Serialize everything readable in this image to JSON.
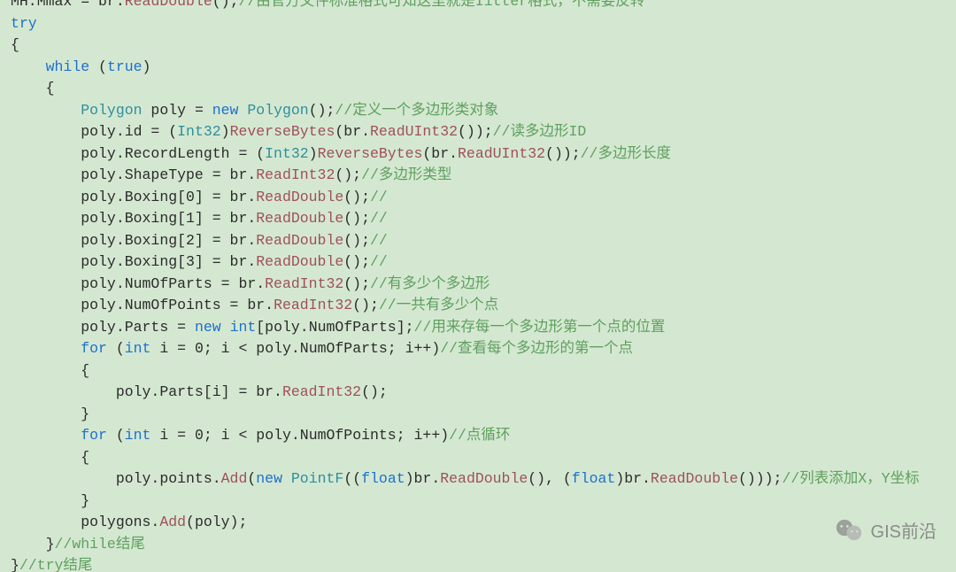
{
  "code": {
    "l00a": "MH.Mmax = ",
    "l00b": "br",
    "l00c": ".",
    "l00d": "ReadDouble",
    "l00e": "();",
    "l00f": "//由官方文件标准格式可知这里就是Iitter格式，不需要反转",
    "l01a": "try",
    "l02a": "{",
    "l03a": "    ",
    "l03b": "while",
    "l03c": " (",
    "l03d": "true",
    "l03e": ")",
    "l04a": "    {",
    "l05i": "        ",
    "l05a": "Polygon",
    "l05b": " poly = ",
    "l05c": "new",
    "l05d": " ",
    "l05e": "Polygon",
    "l05f": "();",
    "l05g": "//定义一个多边形类对象",
    "l06i": "        poly.id = (",
    "l06a": "Int32",
    "l06b": ")",
    "l06c": "ReverseBytes",
    "l06d": "(br.",
    "l06e": "ReadUInt32",
    "l06f": "());",
    "l06g": "//读多边形ID",
    "l07i": "        poly.RecordLength = (",
    "l07a": "Int32",
    "l07b": ")",
    "l07c": "ReverseBytes",
    "l07d": "(br.",
    "l07e": "ReadUInt32",
    "l07f": "());",
    "l07g": "//多边形长度",
    "l08i": "        poly.ShapeType = br.",
    "l08a": "ReadInt32",
    "l08b": "();",
    "l08c": "//多边形类型",
    "l09i": "        poly.Boxing[0] = br.",
    "l09a": "ReadDouble",
    "l09b": "();",
    "l09c": "//",
    "l10i": "        poly.Boxing[1] = br.",
    "l10a": "ReadDouble",
    "l10b": "();",
    "l10c": "//",
    "l11i": "        poly.Boxing[2] = br.",
    "l11a": "ReadDouble",
    "l11b": "();",
    "l11c": "//",
    "l12i": "        poly.Boxing[3] = br.",
    "l12a": "ReadDouble",
    "l12b": "();",
    "l12c": "//",
    "l13i": "        poly.NumOfParts = br.",
    "l13a": "ReadInt32",
    "l13b": "();",
    "l13c": "//有多少个多边形",
    "l14i": "        poly.NumOfPoints = br.",
    "l14a": "ReadInt32",
    "l14b": "();",
    "l14c": "//一共有多少个点",
    "l15i": "        poly.Parts = ",
    "l15a": "new",
    "l15b": " ",
    "l15c": "int",
    "l15d": "[poly.NumOfParts];",
    "l15e": "//用来存每一个多边形第一个点的位置",
    "l16i": "        ",
    "l16a": "for",
    "l16b": " (",
    "l16c": "int",
    "l16d": " i = 0; i < poly.NumOfParts; i++)",
    "l16e": "//查看每个多边形的第一个点",
    "l17i": "        {",
    "l18i": "            poly.Parts[i] = br.",
    "l18a": "ReadInt32",
    "l18b": "();",
    "l19i": "        }",
    "l20i": "        ",
    "l20a": "for",
    "l20b": " (",
    "l20c": "int",
    "l20d": " i = 0; i < poly.NumOfPoints; i++)",
    "l20e": "//点循环",
    "l21i": "        {",
    "l22i": "            poly.points.",
    "l22a": "Add",
    "l22b": "(",
    "l22c": "new",
    "l22d": " ",
    "l22e": "PointF",
    "l22f": "((",
    "l22g": "float",
    "l22h": ")br.",
    "l22j": "ReadDouble",
    "l22k": "(), (",
    "l22l": "float",
    "l22m": ")br.",
    "l22n": "ReadDouble",
    "l22o": "()));",
    "l22p": "//列表添加X，Y坐标",
    "l23i": "        }",
    "l24i": "        polygons.",
    "l24a": "Add",
    "l24b": "(poly);",
    "l25i": "    }",
    "l25a": "//while结尾",
    "l26i": "}",
    "l26a": "//try结尾"
  },
  "watermark": "GIS前沿"
}
